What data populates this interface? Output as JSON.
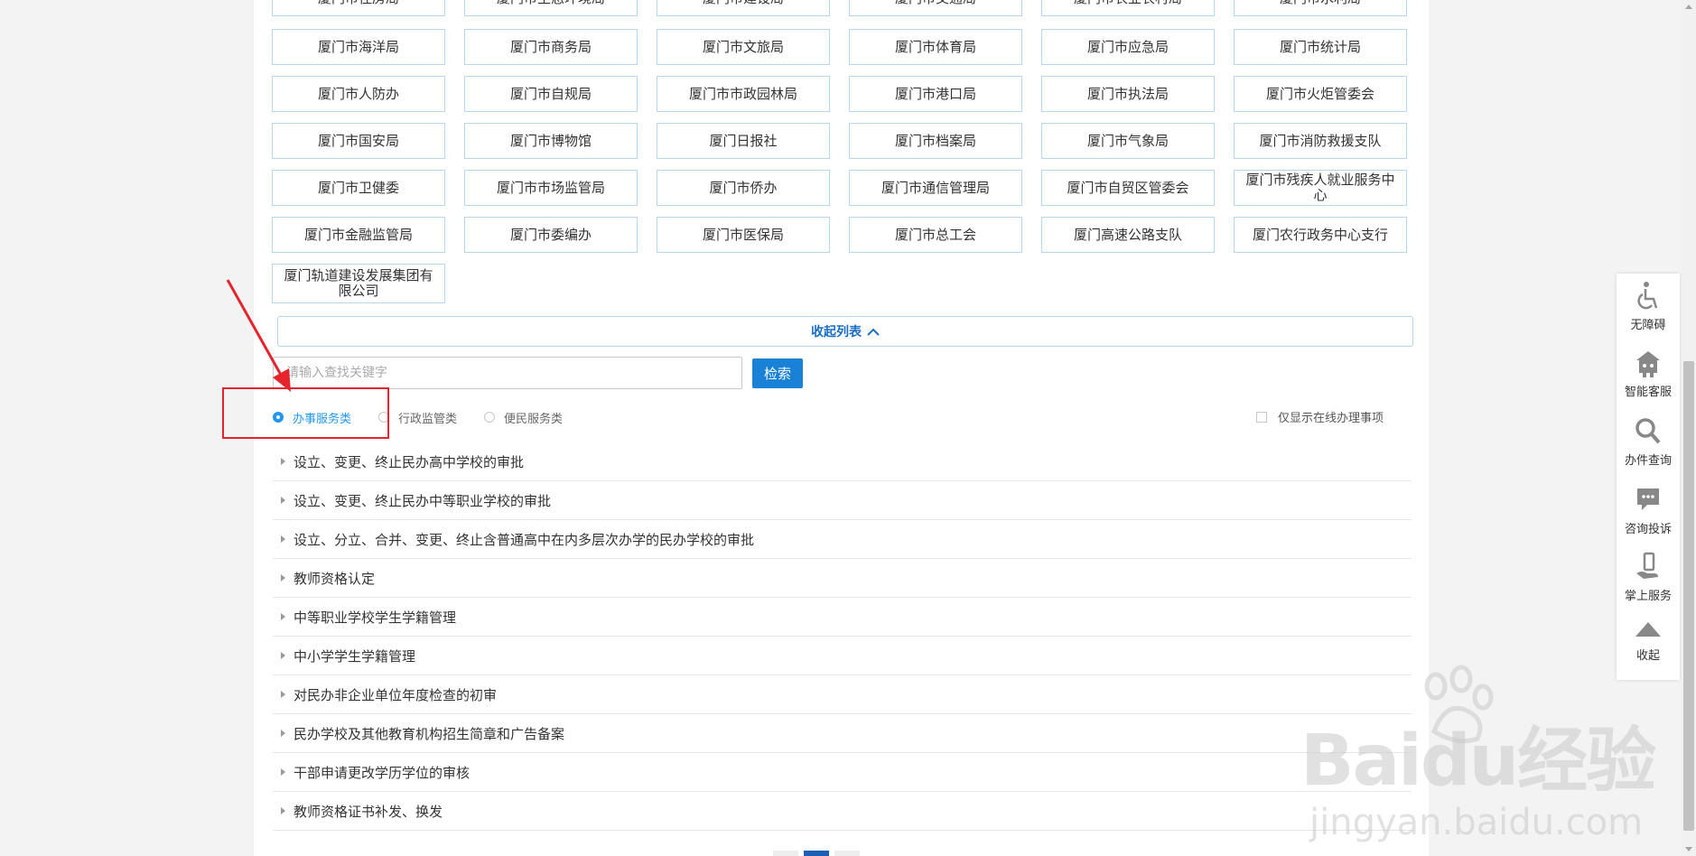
{
  "departments": [
    "厦门市住房局",
    "厦门市生态环境局",
    "厦门市建设局",
    "厦门市交通局",
    "厦门市农业农村局",
    "厦门市水利局",
    "厦门市海洋局",
    "厦门市商务局",
    "厦门市文旅局",
    "厦门市体育局",
    "厦门市应急局",
    "厦门市统计局",
    "厦门市人防办",
    "厦门市自规局",
    "厦门市市政园林局",
    "厦门市港口局",
    "厦门市执法局",
    "厦门市火炬管委会",
    "厦门市国安局",
    "厦门市博物馆",
    "厦门日报社",
    "厦门市档案局",
    "厦门市气象局",
    "厦门市消防救援支队",
    "厦门市卫健委",
    "厦门市市场监管局",
    "厦门市侨办",
    "厦门市通信管理局",
    "厦门市自贸区管委会",
    "厦门市残疾人就业服务中心",
    "厦门市金融监管局",
    "厦门市委编办",
    "厦门市医保局",
    "厦门市总工会",
    "厦门高速公路支队",
    "厦门农行政务中心支行",
    "厦门轨道建设发展集团有限公司"
  ],
  "collapse_label": "收起列表",
  "search": {
    "placeholder": "请输入查找关键字",
    "button": "检索"
  },
  "categories": [
    {
      "label": "办事服务类",
      "selected": true
    },
    {
      "label": "行政监管类",
      "selected": false
    },
    {
      "label": "便民服务类",
      "selected": false
    }
  ],
  "online_only_label": "仅显示在线办理事项",
  "items": [
    "设立、变更、终止民办高中学校的审批",
    "设立、变更、终止民办中等职业学校的审批",
    "设立、分立、合并、变更、终止含普通高中在内多层次办学的民办学校的审批",
    "教师资格认定",
    "中等职业学校学生学籍管理",
    "中小学学生学籍管理",
    "对民办非企业单位年度检查的初审",
    "民办学校及其他教育机构招生简章和广告备案",
    "干部申请更改学历学位的审核",
    "教师资格证书补发、换发"
  ],
  "side_panel": [
    {
      "label": "无障碍",
      "icon": "wheelchair-icon"
    },
    {
      "label": "智能客服",
      "icon": "robot-icon"
    },
    {
      "label": "办件查询",
      "icon": "search-icon"
    },
    {
      "label": "咨询投诉",
      "icon": "chat-icon"
    },
    {
      "label": "掌上服务",
      "icon": "phone-hand-icon"
    },
    {
      "label": "收起",
      "icon": "triangle-up-icon"
    }
  ],
  "watermark": {
    "brand": "Baidu经验",
    "url": "jingyan.baidu.com"
  },
  "colors": {
    "accent": "#1a82d6",
    "selected": "#2196f3",
    "annotation": "#e6242c",
    "border": "#b7d6ef"
  }
}
